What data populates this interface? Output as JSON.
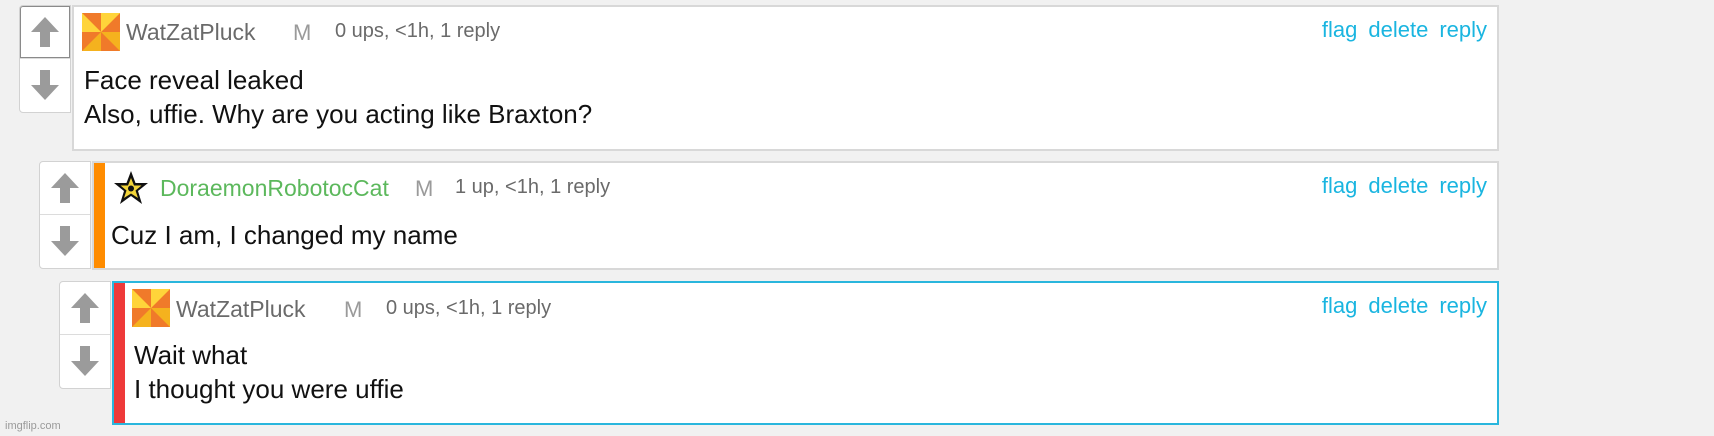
{
  "comments": [
    {
      "username": "WatZatPluck",
      "mod": "M",
      "meta": "0 ups, <1h, 1 reply",
      "text_lines": [
        "Face reveal leaked",
        "Also, uffie. Why are you acting like Braxton?"
      ]
    },
    {
      "username": "DoraemonRobotocCat",
      "mod": "M",
      "meta": "1 up, <1h, 1 reply",
      "text_lines": [
        "Cuz I am, I changed my name"
      ]
    },
    {
      "username": "WatZatPluck",
      "mod": "M",
      "meta": "0 ups, <1h, 1 reply",
      "text_lines": [
        "Wait what",
        "I thought you were uffie"
      ]
    }
  ],
  "actions": {
    "flag": "flag",
    "delete": "delete",
    "reply": "reply"
  },
  "watermark": "imgflip.com",
  "colors": {
    "link": "#1ab5e0",
    "stripe_reply_1": "#ff8c00",
    "stripe_reply_2": "#ee3a3a",
    "selected_border": "#29b6dd",
    "username_green": "#5cb85c"
  }
}
